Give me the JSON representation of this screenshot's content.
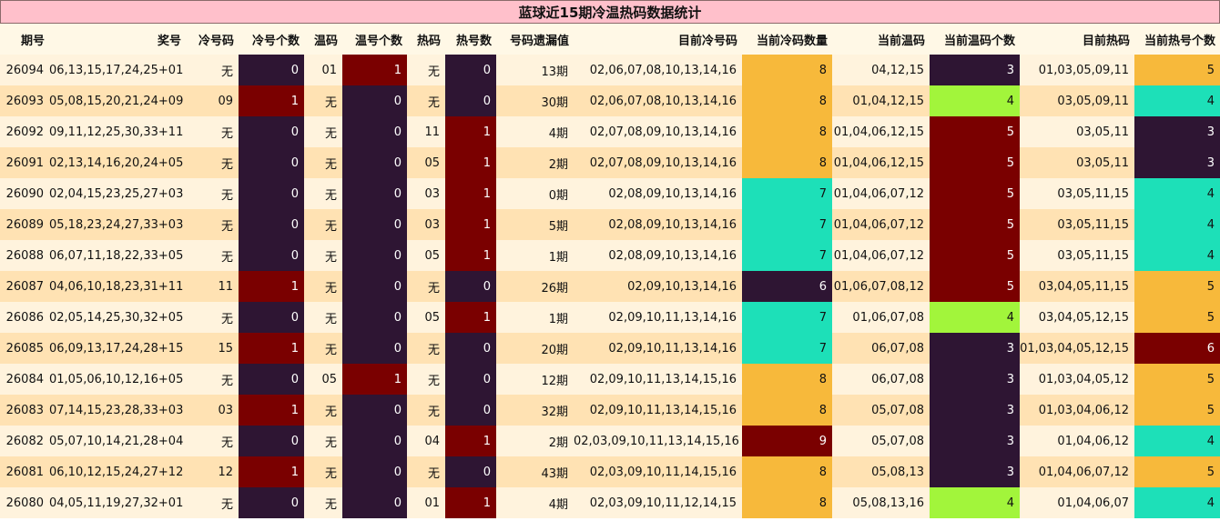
{
  "title": "蓝球近15期冷温热码数据统计",
  "colors": {
    "dark": "#2e1533",
    "red": "#7a0000",
    "teal": "#1de0b8",
    "orange": "#f7b93b",
    "lime": "#a2f53b",
    "row_light": "#fff3dd",
    "row_dark": "#ffe2b3",
    "title_bg": "#ffc0cb"
  },
  "headers": [
    "期号",
    "奖号",
    "冷号码",
    "冷号个数",
    "温码",
    "温号个数",
    "热码",
    "热号数",
    "号码遗漏值",
    "目前冷号码",
    "当前冷码数量",
    "当前温码",
    "当前温码个数",
    "目前热码",
    "当前热号个数"
  ],
  "rows": [
    [
      "26094",
      "06,13,15,17,24,25+01",
      "无",
      "0",
      "01",
      "1",
      "无",
      "0",
      "13期",
      "02,06,07,08,10,13,14,16",
      "8",
      "04,12,15",
      "3",
      "01,03,05,09,11",
      "5"
    ],
    [
      "26093",
      "05,08,15,20,21,24+09",
      "09",
      "1",
      "无",
      "0",
      "无",
      "0",
      "30期",
      "02,06,07,08,10,13,14,16",
      "8",
      "01,04,12,15",
      "4",
      "03,05,09,11",
      "4"
    ],
    [
      "26092",
      "09,11,12,25,30,33+11",
      "无",
      "0",
      "无",
      "0",
      "11",
      "1",
      "4期",
      "02,07,08,09,10,13,14,16",
      "8",
      "01,04,06,12,15",
      "5",
      "03,05,11",
      "3"
    ],
    [
      "26091",
      "02,13,14,16,20,24+05",
      "无",
      "0",
      "无",
      "0",
      "05",
      "1",
      "2期",
      "02,07,08,09,10,13,14,16",
      "8",
      "01,04,06,12,15",
      "5",
      "03,05,11",
      "3"
    ],
    [
      "26090",
      "02,04,15,23,25,27+03",
      "无",
      "0",
      "无",
      "0",
      "03",
      "1",
      "0期",
      "02,08,09,10,13,14,16",
      "7",
      "01,04,06,07,12",
      "5",
      "03,05,11,15",
      "4"
    ],
    [
      "26089",
      "05,18,23,24,27,33+03",
      "无",
      "0",
      "无",
      "0",
      "03",
      "1",
      "5期",
      "02,08,09,10,13,14,16",
      "7",
      "01,04,06,07,12",
      "5",
      "03,05,11,15",
      "4"
    ],
    [
      "26088",
      "06,07,11,18,22,33+05",
      "无",
      "0",
      "无",
      "0",
      "05",
      "1",
      "1期",
      "02,08,09,10,13,14,16",
      "7",
      "01,04,06,07,12",
      "5",
      "03,05,11,15",
      "4"
    ],
    [
      "26087",
      "04,06,10,18,23,31+11",
      "11",
      "1",
      "无",
      "0",
      "无",
      "0",
      "26期",
      "02,09,10,13,14,16",
      "6",
      "01,06,07,08,12",
      "5",
      "03,04,05,11,15",
      "5"
    ],
    [
      "26086",
      "02,05,14,25,30,32+05",
      "无",
      "0",
      "无",
      "0",
      "05",
      "1",
      "1期",
      "02,09,10,11,13,14,16",
      "7",
      "01,06,07,08",
      "4",
      "03,04,05,12,15",
      "5"
    ],
    [
      "26085",
      "06,09,13,17,24,28+15",
      "15",
      "1",
      "无",
      "0",
      "无",
      "0",
      "20期",
      "02,09,10,11,13,14,16",
      "7",
      "06,07,08",
      "3",
      "01,03,04,05,12,15",
      "6"
    ],
    [
      "26084",
      "01,05,06,10,12,16+05",
      "无",
      "0",
      "05",
      "1",
      "无",
      "0",
      "12期",
      "02,09,10,11,13,14,15,16",
      "8",
      "06,07,08",
      "3",
      "01,03,04,05,12",
      "5"
    ],
    [
      "26083",
      "07,14,15,23,28,33+03",
      "03",
      "1",
      "无",
      "0",
      "无",
      "0",
      "32期",
      "02,09,10,11,13,14,15,16",
      "8",
      "05,07,08",
      "3",
      "01,03,04,06,12",
      "5"
    ],
    [
      "26082",
      "05,07,10,14,21,28+04",
      "无",
      "0",
      "无",
      "0",
      "04",
      "1",
      "2期",
      "02,03,09,10,11,13,14,15,16",
      "9",
      "05,07,08",
      "3",
      "01,04,06,12",
      "4"
    ],
    [
      "26081",
      "06,10,12,15,24,27+12",
      "12",
      "1",
      "无",
      "0",
      "无",
      "0",
      "43期",
      "02,03,09,10,11,14,15,16",
      "8",
      "05,08,13",
      "3",
      "01,04,06,07,12",
      "5"
    ],
    [
      "26080",
      "04,05,11,19,27,32+01",
      "无",
      "0",
      "无",
      "0",
      "01",
      "1",
      "4期",
      "02,03,09,10,11,12,14,15",
      "8",
      "05,08,13,16",
      "4",
      "01,04,06,07",
      "4"
    ]
  ]
}
